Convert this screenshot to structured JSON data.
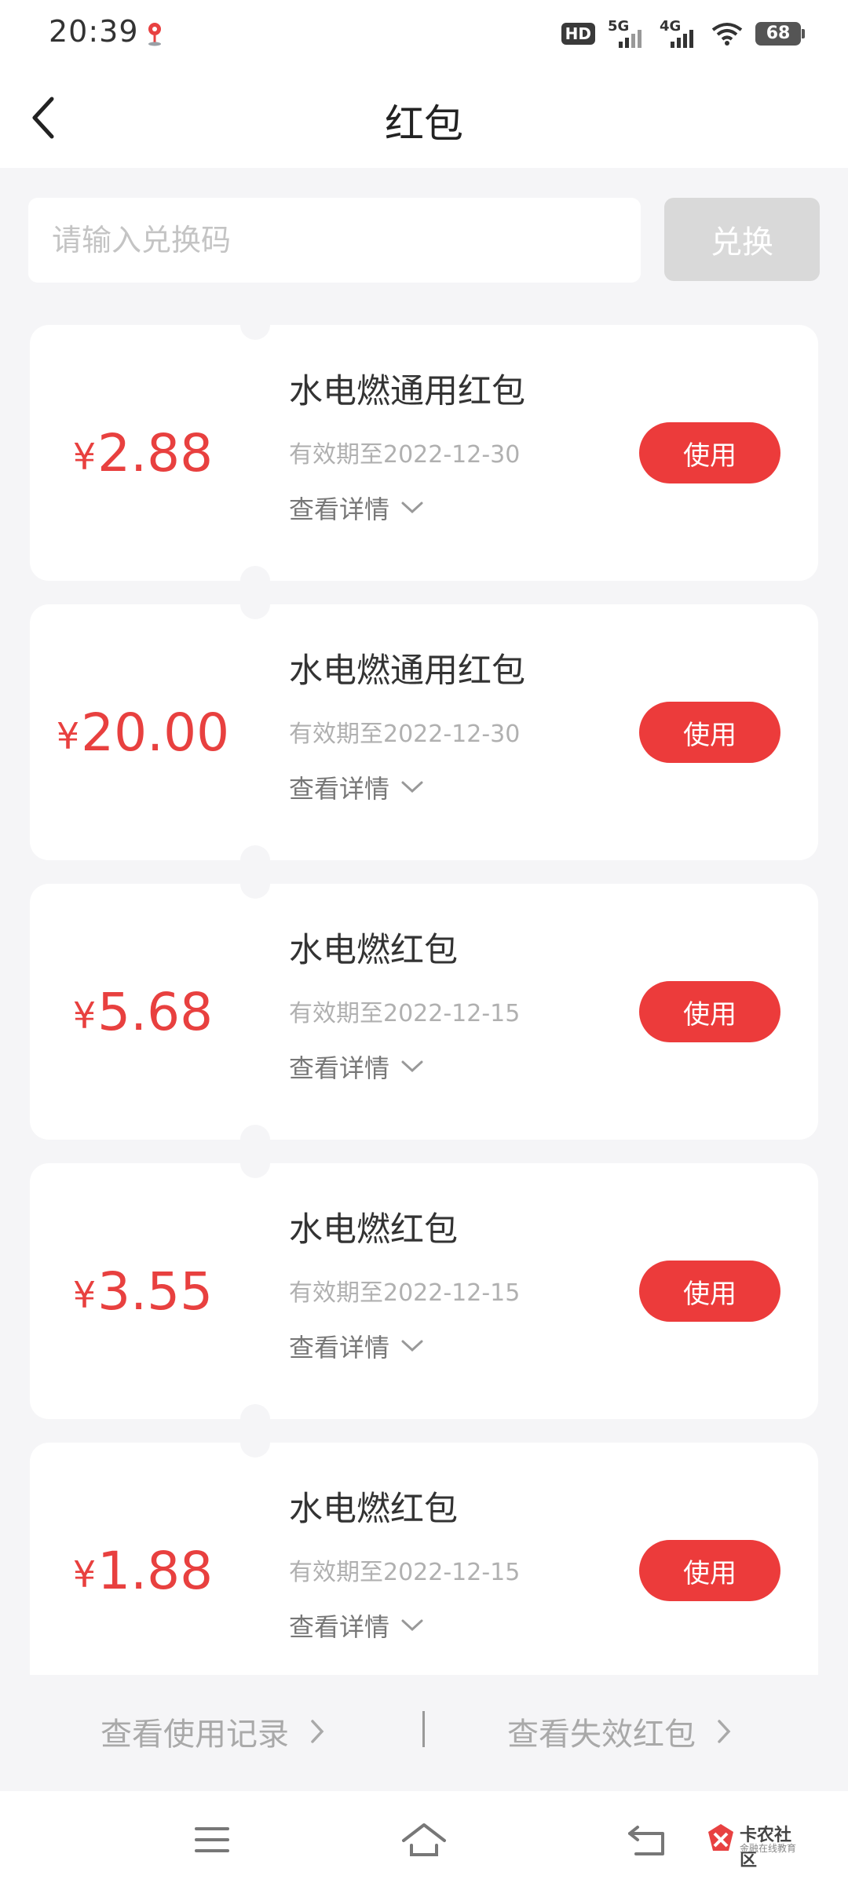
{
  "status_bar": {
    "time": "20:39",
    "hd_badge": "HD",
    "network_1": "5G",
    "network_2": "4G",
    "battery": "68"
  },
  "header": {
    "title": "红包",
    "back_icon": "chevron-left-icon"
  },
  "redeem": {
    "placeholder": "请输入兑换码",
    "value": "",
    "button_label": "兑换"
  },
  "coupons": [
    {
      "currency": "¥",
      "amount": "2.88",
      "name": "水电燃通用红包",
      "expiry": "有效期至2022-12-30",
      "details_label": "查看详情",
      "use_label": "使用"
    },
    {
      "currency": "¥",
      "amount": "20.00",
      "name": "水电燃通用红包",
      "expiry": "有效期至2022-12-30",
      "details_label": "查看详情",
      "use_label": "使用"
    },
    {
      "currency": "¥",
      "amount": "5.68",
      "name": "水电燃红包",
      "expiry": "有效期至2022-12-15",
      "details_label": "查看详情",
      "use_label": "使用"
    },
    {
      "currency": "¥",
      "amount": "3.55",
      "name": "水电燃红包",
      "expiry": "有效期至2022-12-15",
      "details_label": "查看详情",
      "use_label": "使用"
    },
    {
      "currency": "¥",
      "amount": "1.88",
      "name": "水电燃红包",
      "expiry": "有效期至2022-12-15",
      "details_label": "查看详情",
      "use_label": "使用"
    }
  ],
  "bottom_links": {
    "history": "查看使用记录",
    "expired": "查看失效红包"
  },
  "watermark": {
    "name": "卡农社区",
    "sub": "金融在线教育"
  },
  "colors": {
    "accent_red": "#ec3b3b",
    "amount_red": "#e8403f",
    "page_bg": "#f5f5f7",
    "disabled_button": "#d9d9d9"
  }
}
